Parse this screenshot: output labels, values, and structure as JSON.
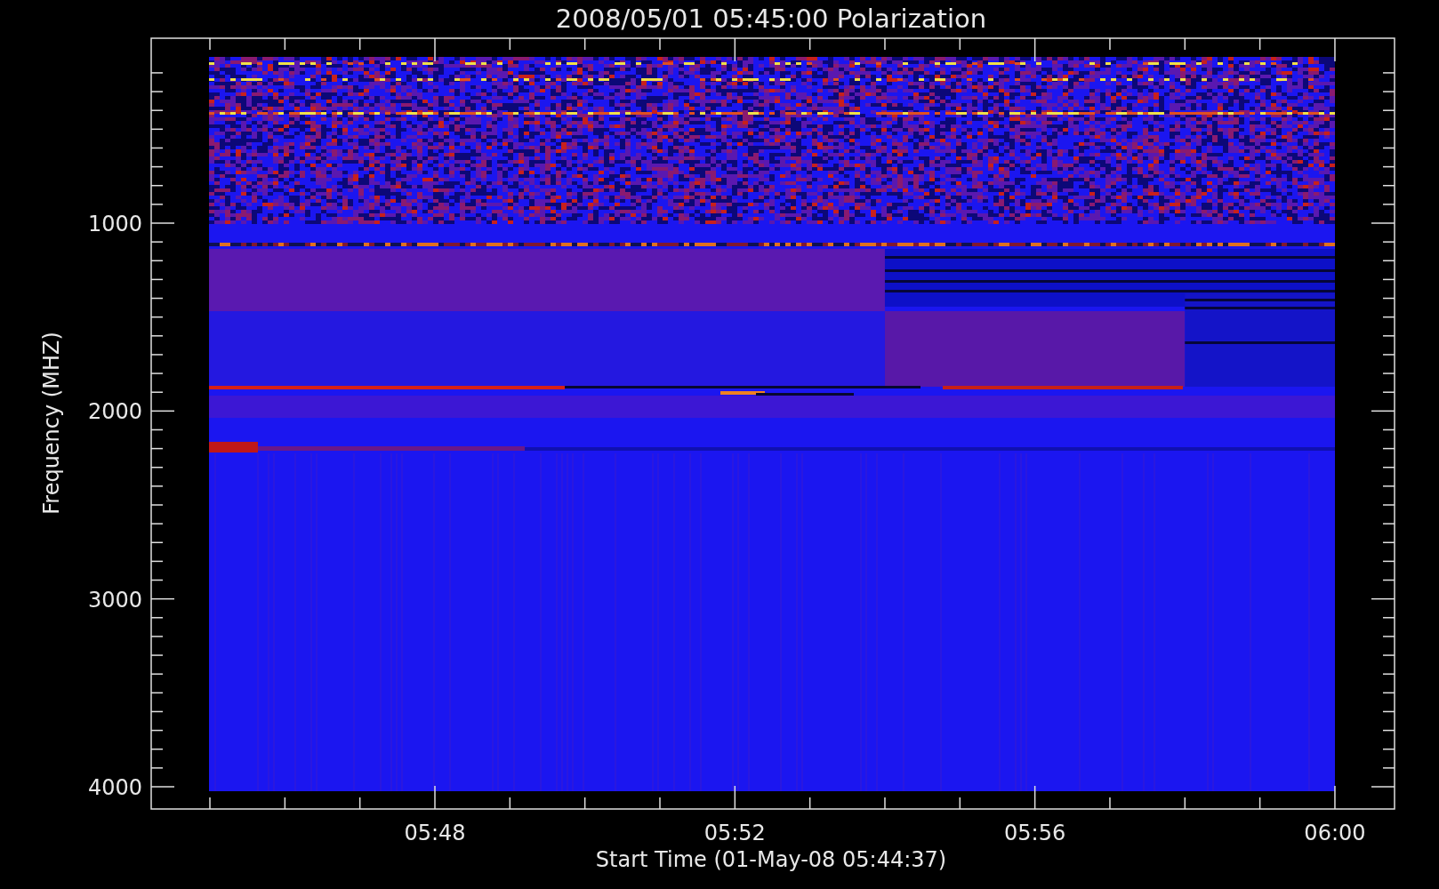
{
  "plot": {
    "title": "2008/05/01 05:45:00 Polarization",
    "ylabel": "Frequency (MHZ)",
    "xlabel": "Start Time (01-May-08 05:44:37)",
    "yticks": [
      "1000",
      "2000",
      "3000",
      "4000"
    ],
    "xticks": [
      "05:48",
      "05:52",
      "05:56",
      "06:00"
    ]
  }
}
